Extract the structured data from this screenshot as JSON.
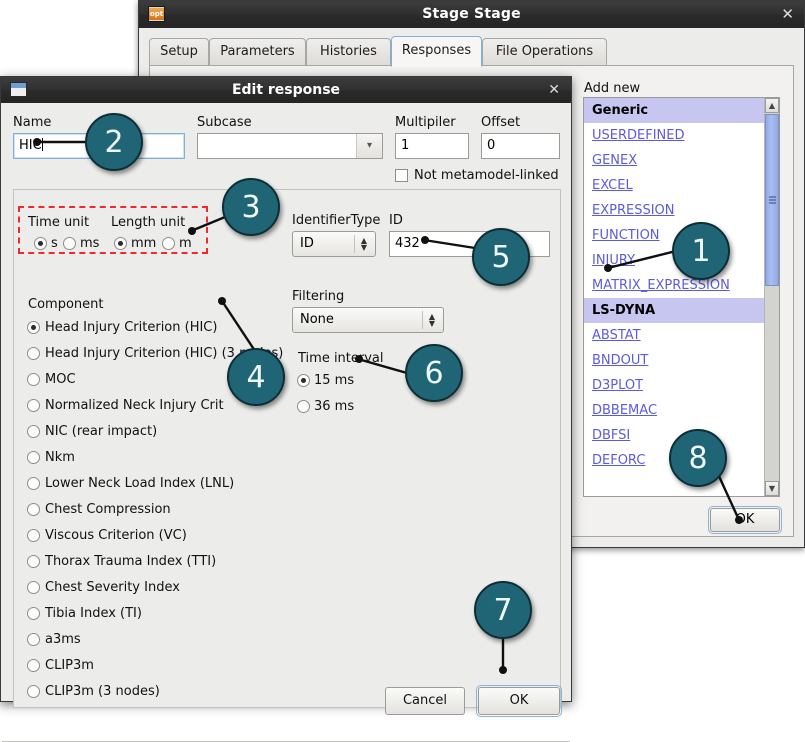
{
  "stage_window": {
    "title": "Stage Stage",
    "app_icon": "opt-folder-icon",
    "close_label": "✕",
    "tabs": [
      {
        "label": "Setup",
        "active": false
      },
      {
        "label": "Parameters",
        "active": false
      },
      {
        "label": "Histories",
        "active": false
      },
      {
        "label": "Responses",
        "active": true
      },
      {
        "label": "File Operations",
        "active": false
      }
    ],
    "add_new": {
      "label": "Add new",
      "ok_label": "OK",
      "scroll_up_icon": "▲",
      "scroll_down_icon": "▼",
      "items": [
        {
          "label": "Generic",
          "type": "group"
        },
        {
          "label": "USERDEFINED",
          "type": "link"
        },
        {
          "label": "GENEX",
          "type": "link"
        },
        {
          "label": "EXCEL",
          "type": "link"
        },
        {
          "label": "EXPRESSION",
          "type": "link"
        },
        {
          "label": "FUNCTION",
          "type": "link"
        },
        {
          "label": "INJURY",
          "type": "link"
        },
        {
          "label": "MATRIX_EXPRESSION",
          "type": "link"
        },
        {
          "label": "LS-DYNA",
          "type": "group"
        },
        {
          "label": "ABSTAT",
          "type": "link"
        },
        {
          "label": "BNDOUT",
          "type": "link"
        },
        {
          "label": "D3PLOT",
          "type": "link"
        },
        {
          "label": "DBBEMAC",
          "type": "link"
        },
        {
          "label": "DBFSI",
          "type": "link"
        },
        {
          "label": "DEFORC",
          "type": "link"
        }
      ]
    }
  },
  "edit_dialog": {
    "title": "Edit response",
    "icon": "window-icon",
    "close_label": "✕",
    "name": {
      "label": "Name",
      "value": "HIC"
    },
    "subcase": {
      "label": "Subcase",
      "value": "",
      "arrow_icon": "chevron-down-icon"
    },
    "multiplier": {
      "label": "Multipiler",
      "value": "1"
    },
    "offset": {
      "label": "Offset",
      "value": "0"
    },
    "not_metamodel_linked": {
      "label": "Not metamodel-linked",
      "checked": false
    },
    "time_unit": {
      "label": "Time unit",
      "options": [
        {
          "label": "s",
          "selected": true
        },
        {
          "label": "ms",
          "selected": false
        }
      ]
    },
    "length_unit": {
      "label": "Length unit",
      "options": [
        {
          "label": "mm",
          "selected": true
        },
        {
          "label": "m",
          "selected": false
        }
      ]
    },
    "identifier_type": {
      "label": "IdentifierType",
      "value": "ID"
    },
    "id": {
      "label": "ID",
      "value": "432"
    },
    "filtering": {
      "label": "Filtering",
      "value": "None"
    },
    "time_interval": {
      "label": "Time interval",
      "options": [
        {
          "label": "15 ms",
          "selected": true
        },
        {
          "label": "36 ms",
          "selected": false
        }
      ]
    },
    "component": {
      "label": "Component",
      "options": [
        {
          "label": "Head Injury Criterion (HIC)",
          "selected": true
        },
        {
          "label": "Head Injury Criterion (HIC) (3 nodes)",
          "selected": false
        },
        {
          "label": "MOC",
          "selected": false
        },
        {
          "label": "Normalized Neck Injury Crit",
          "selected": false
        },
        {
          "label": "NIC (rear impact)",
          "selected": false
        },
        {
          "label": "Nkm",
          "selected": false
        },
        {
          "label": "Lower Neck Load Index (LNL)",
          "selected": false
        },
        {
          "label": "Chest Compression",
          "selected": false
        },
        {
          "label": "Viscous Criterion (VC)",
          "selected": false
        },
        {
          "label": "Thorax Trauma Index (TTI)",
          "selected": false
        },
        {
          "label": "Chest Severity Index",
          "selected": false
        },
        {
          "label": "Tibia Index (TI)",
          "selected": false
        },
        {
          "label": "a3ms",
          "selected": false
        },
        {
          "label": "CLIP3m",
          "selected": false
        },
        {
          "label": "CLIP3m (3 nodes)",
          "selected": false
        }
      ]
    },
    "cancel_label": "Cancel",
    "ok_label": "OK"
  },
  "callouts": [
    {
      "number": "1"
    },
    {
      "number": "2"
    },
    {
      "number": "3"
    },
    {
      "number": "4"
    },
    {
      "number": "5"
    },
    {
      "number": "6"
    },
    {
      "number": "7"
    },
    {
      "number": "8"
    }
  ],
  "colors": {
    "callout_fill": "#1f6576",
    "callout_border": "#0e2e36",
    "annotation_dash": "#ef2a2a",
    "link": "#5b5be0",
    "group_header": "#c6c6f0",
    "window_chrome": "#2d2d2d",
    "dialog_bg": "#ececea"
  }
}
